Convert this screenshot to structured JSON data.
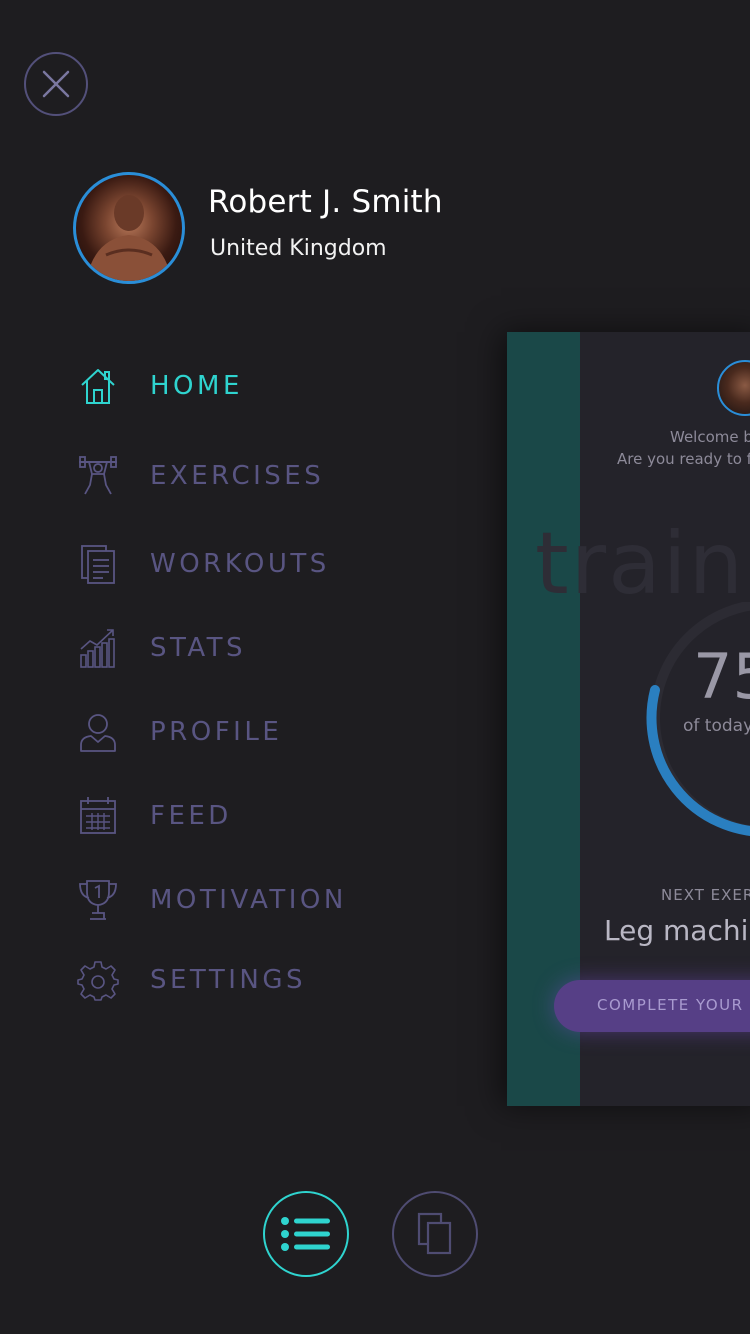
{
  "profile": {
    "name": "Robert J. Smith",
    "location": "United Kingdom"
  },
  "nav": {
    "items": [
      {
        "label": "HOME",
        "icon": "home-icon",
        "active": true
      },
      {
        "label": "EXERCISES",
        "icon": "weightlifter-icon",
        "active": false
      },
      {
        "label": "WORKOUTS",
        "icon": "clipboard-icon",
        "active": false
      },
      {
        "label": "STATS",
        "icon": "bar-chart-icon",
        "active": false
      },
      {
        "label": "PROFILE",
        "icon": "user-icon",
        "active": false
      },
      {
        "label": "FEED",
        "icon": "calendar-icon",
        "active": false
      },
      {
        "label": "MOTIVATION",
        "icon": "trophy-icon",
        "active": false
      },
      {
        "label": "SETTINGS",
        "icon": "gear-icon",
        "active": false
      }
    ]
  },
  "preview": {
    "welcome_line1": "Welcome b",
    "welcome_line2": "Are you ready to fi",
    "watermark": "train",
    "progress_value": "75",
    "progress_caption": "of today",
    "next_label": "NEXT EXER",
    "next_name": "Leg machin",
    "complete_label": "COMPLETE YOUR"
  },
  "colors": {
    "background": "#1e1d20",
    "accent": "#2fd4cf",
    "inactive": "#595582",
    "avatar_ring": "#2a8ed8",
    "button_purple": "#563f86"
  }
}
